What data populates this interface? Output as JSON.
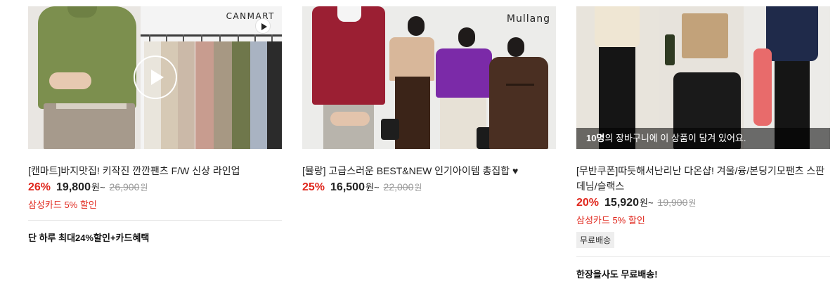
{
  "products": [
    {
      "logo": "CANMART",
      "title": "[캔마트]바지맛집! 키작진 깐깐팬츠 F/W 신상 라인업",
      "rate": "26%",
      "price": "19,800",
      "price_unit": "원",
      "price_suffix": "~",
      "original_price": "26,900",
      "original_unit": "원",
      "card_deal": "삼성카드 5% 할인",
      "promo": "단 하루 최대24%할인+카드혜택"
    },
    {
      "logo": "Mullang",
      "title": "[뮬랑] 고급스러운 BEST&NEW 인기아이템 총집합 ♥",
      "rate": "25%",
      "price": "16,500",
      "price_unit": "원",
      "price_suffix": "~",
      "original_price": "22,000",
      "original_unit": "원"
    },
    {
      "title": "[무반쿠폰]따듯해서난리난 다온샵! 겨울/융/본딩기모팬츠 스판데님/슬랙스",
      "rate": "20%",
      "price": "15,920",
      "price_unit": "원",
      "price_suffix": "~",
      "original_price": "19,900",
      "original_unit": "원",
      "card_deal": "삼성카드 5% 할인",
      "shipping_badge": "무료배송",
      "cart_count": "10명",
      "cart_text": "의 장바구니에 이 상품이 담겨 있어요.",
      "promo": "한장을사도 무료배송!"
    }
  ],
  "colors": {
    "discount_red": "#e0281e",
    "strike_gray": "#999999"
  }
}
